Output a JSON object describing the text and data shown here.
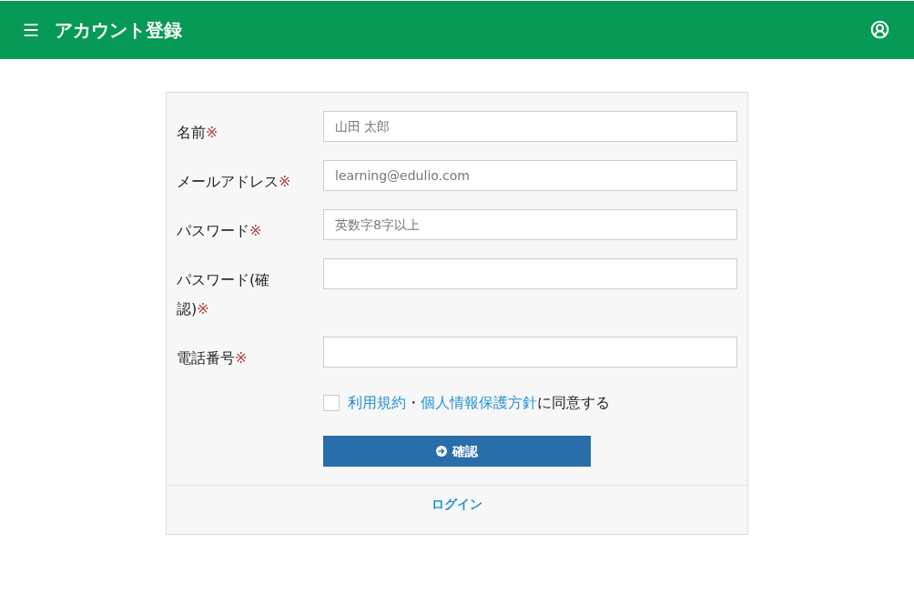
{
  "header": {
    "title": "アカウント登録"
  },
  "form": {
    "fields": [
      {
        "label": "名前",
        "required_mark": "※",
        "placeholder": "山田 太郎"
      },
      {
        "label": "メールアドレス",
        "required_mark": "※",
        "placeholder": "learning@edulio.com"
      },
      {
        "label": "パスワード",
        "required_mark": "※",
        "placeholder": "英数字8字以上"
      },
      {
        "label": "パスワード(確認)",
        "required_mark": "※"
      },
      {
        "label": "電話番号",
        "required_mark": "※"
      }
    ],
    "agreement": {
      "checked": false,
      "links": [
        "利用規約",
        "個人情報保護方針"
      ],
      "separator": "・",
      "text": "に同意する"
    },
    "submit_button": {
      "label": "確認"
    },
    "login_link": "ログイン"
  }
}
